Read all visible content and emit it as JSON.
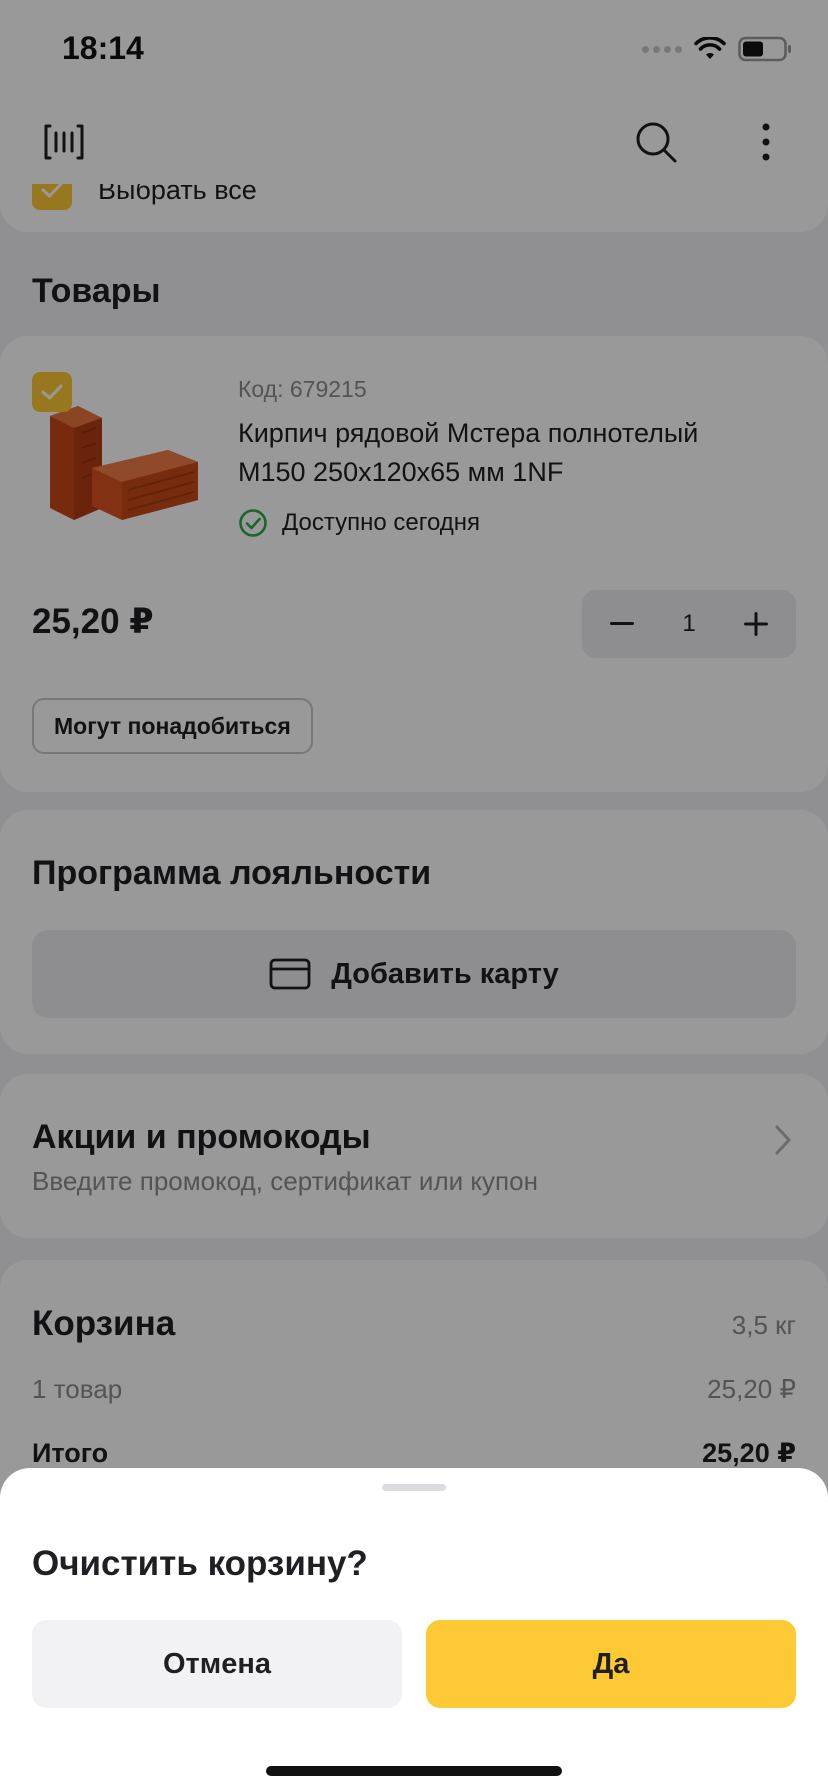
{
  "status_bar": {
    "time": "18:14"
  },
  "header": {
    "barcode_icon": "barcode-scan-icon",
    "search_icon": "search-icon",
    "more_icon": "more-vertical-icon"
  },
  "select_all": {
    "label": "Выбрать все",
    "checked": true
  },
  "products_section": {
    "title": "Товары"
  },
  "product": {
    "code": "Код: 679215",
    "name": "Кирпич рядовой Мстера полнотелый М150 250x120x65 мм 1NF",
    "availability": "Доступно сегодня",
    "price": "25,20 ₽",
    "quantity": "1",
    "minus_label": "−",
    "plus_label": "+",
    "may_need_label": "Могут понадобиться",
    "checked": true
  },
  "loyalty": {
    "title": "Программа лояльности",
    "add_card_label": "Добавить карту"
  },
  "promos": {
    "title": "Акции и промокоды",
    "subtitle": "Введите промокод, сертификат или купон"
  },
  "cart": {
    "title": "Корзина",
    "weight": "3,5 кг",
    "count": "1 товар",
    "subtotal": "25,20 ₽",
    "total_label": "Итого",
    "total_value": "25,20 ₽"
  },
  "dialog": {
    "title": "Очистить корзину?",
    "cancel_label": "Отмена",
    "confirm_label": "Да"
  },
  "colors": {
    "accent_yellow": "#fdc935",
    "success_green": "#2fa84f",
    "brick_orange": "#d9541e",
    "text_primary": "#1f1f24",
    "text_secondary": "#8c8c92"
  }
}
